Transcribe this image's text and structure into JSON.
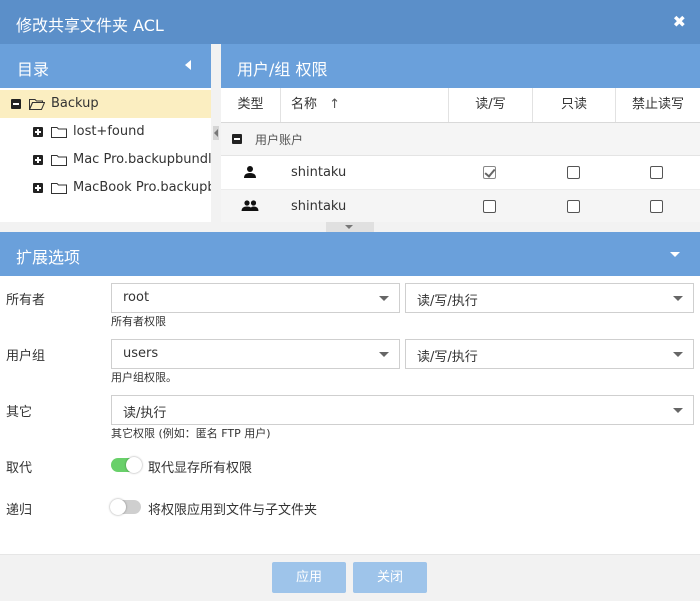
{
  "window": {
    "title": "修改共享文件夹 ACL",
    "close_glyph": "✖"
  },
  "left_panel": {
    "title": "目录",
    "tree": [
      {
        "label": "Backup",
        "expanded": true,
        "selected": true,
        "open_folder": true
      },
      {
        "label": "lost+found",
        "expanded": false
      },
      {
        "label": "Mac Pro.backupbundle",
        "expanded": false
      },
      {
        "label": "MacBook Pro.backupbundle",
        "expanded": false
      }
    ]
  },
  "right_panel": {
    "title": "用户/组 权限",
    "columns": {
      "type": "类型",
      "name": "名称",
      "sort_glyph": "↑",
      "rw": "读/写",
      "ro": "只读",
      "deny": "禁止读写"
    },
    "group_label": "用户账户",
    "rows": [
      {
        "type_icon": "user-icon",
        "name": "shintaku",
        "rw": true,
        "ro": false,
        "deny": false
      },
      {
        "type_icon": "group-icon",
        "name": "shintaku",
        "rw": false,
        "ro": false,
        "deny": false
      }
    ]
  },
  "extended": {
    "title": "扩展选项",
    "owner": {
      "label": "所有者",
      "value": "root",
      "perm": "读/写/执行",
      "hint": "所有者权限"
    },
    "group": {
      "label": "用户组",
      "value": "users",
      "perm": "读/写/执行",
      "hint": "用户组权限。"
    },
    "other": {
      "label": "其它",
      "perm": "读/执行",
      "hint": "其它权限 (例如：匿名 FTP 用户)"
    },
    "replace": {
      "label": "取代",
      "text": "取代显存所有权限",
      "on": true
    },
    "recursive": {
      "label": "递归",
      "text": "将权限应用到文件与子文件夹",
      "on": false
    }
  },
  "footer": {
    "apply": "应用",
    "close": "关闭"
  },
  "colors": {
    "titlebar": "#5b8fc9",
    "panel_header": "#6aa0db",
    "selected_row": "#fbeec1",
    "toggle_on": "#69d06a",
    "button": "#9ec4ea"
  }
}
